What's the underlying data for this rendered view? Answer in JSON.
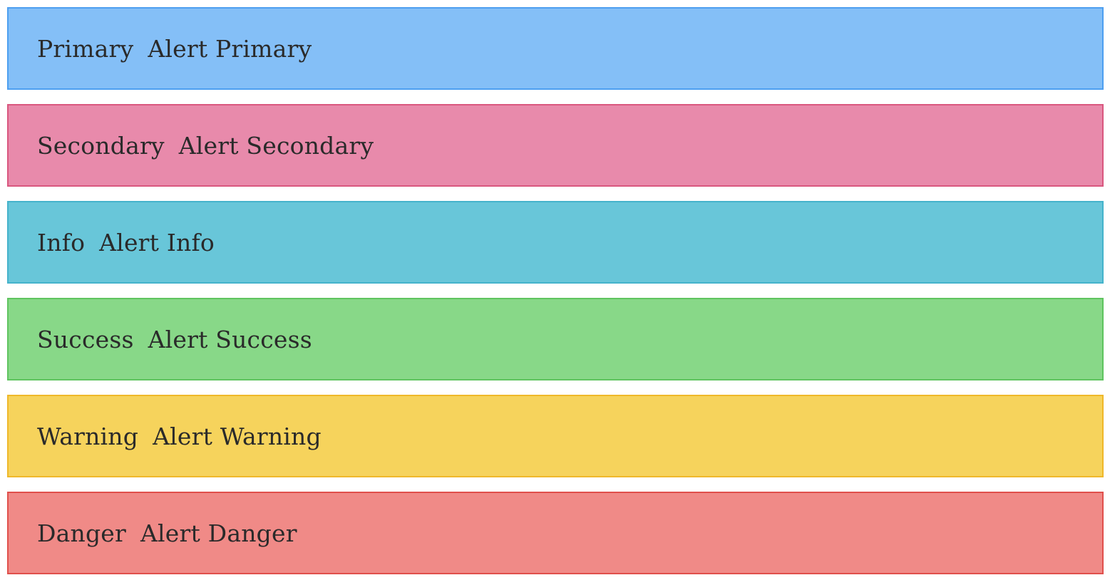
{
  "alerts": [
    {
      "title": "Primary",
      "message": "Alert Primary",
      "bg": "#84bff7",
      "border": "#4d9ff0"
    },
    {
      "title": "Secondary",
      "message": "Alert Secondary",
      "bg": "#e88aab",
      "border": "#d9577f"
    },
    {
      "title": "Info",
      "message": "Alert Info",
      "bg": "#68c6d9",
      "border": "#45b3cb"
    },
    {
      "title": "Success",
      "message": "Alert Success",
      "bg": "#88d888",
      "border": "#5fc45f"
    },
    {
      "title": "Warning",
      "message": "Alert Warning",
      "bg": "#f6d35c",
      "border": "#efb82a"
    },
    {
      "title": "Danger",
      "message": "Alert Danger",
      "bg": "#f08a87",
      "border": "#e0504c"
    }
  ]
}
